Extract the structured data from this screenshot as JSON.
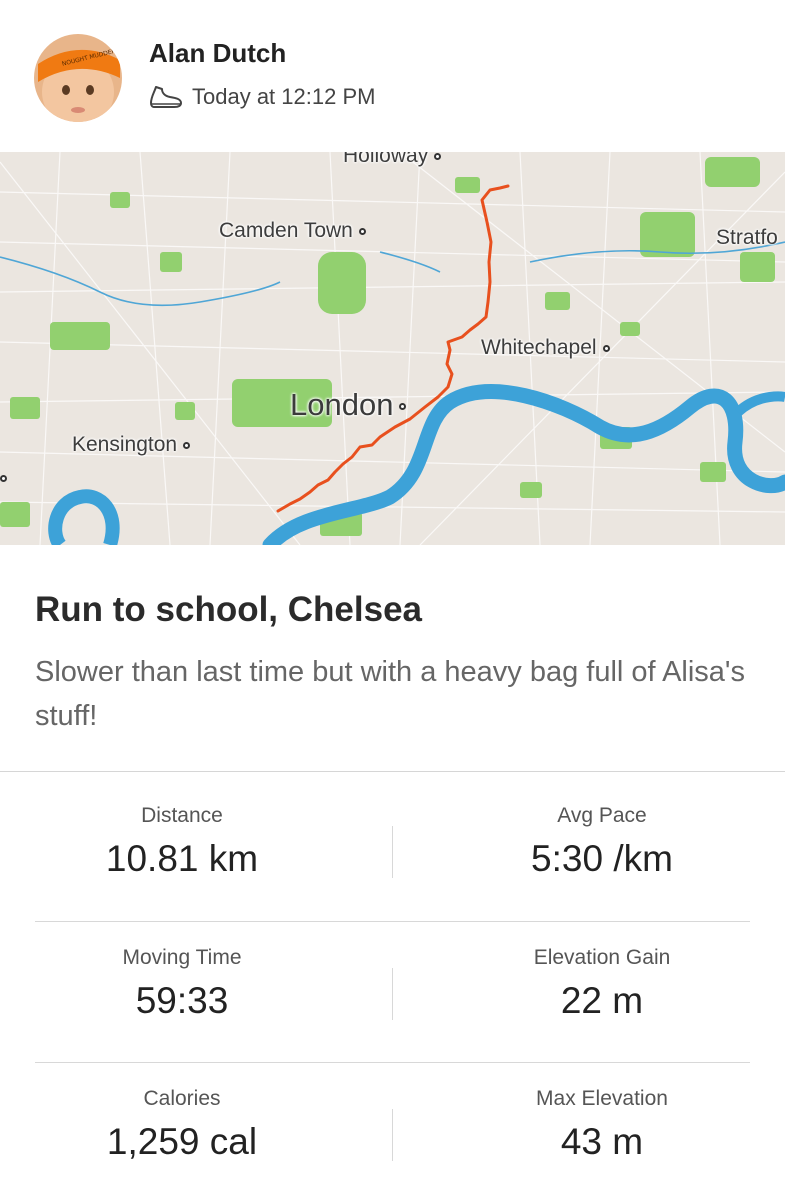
{
  "post": {
    "author_name": "Alan Dutch",
    "timestamp": "Today at 12:12 PM",
    "activity_icon": "running-shoe-icon",
    "avatar_headband_text": "NOUGHT MUDDER"
  },
  "map": {
    "labels": {
      "holloway": "Holloway",
      "camden_town": "Camden Town",
      "stratford": "Stratfo",
      "whitechapel": "Whitechapel",
      "london": "London",
      "kensington": "Kensington"
    },
    "route_color": "#e8501e",
    "river_color": "#3aa3d9",
    "park_color": "#8fd16e"
  },
  "activity": {
    "title": "Run to school, Chelsea",
    "description": "Slower than last time but with a heavy bag full of Alisa's stuff!"
  },
  "stats": {
    "distance_label": "Distance",
    "distance_value": "10.81 km",
    "avg_pace_label": "Avg Pace",
    "avg_pace_value": "5:30 /km",
    "moving_time_label": "Moving Time",
    "moving_time_value": "59:33",
    "elevation_gain_label": "Elevation Gain",
    "elevation_gain_value": "22 m",
    "calories_label": "Calories",
    "calories_value": "1,259 cal",
    "max_elevation_label": "Max Elevation",
    "max_elevation_value": "43 m"
  }
}
